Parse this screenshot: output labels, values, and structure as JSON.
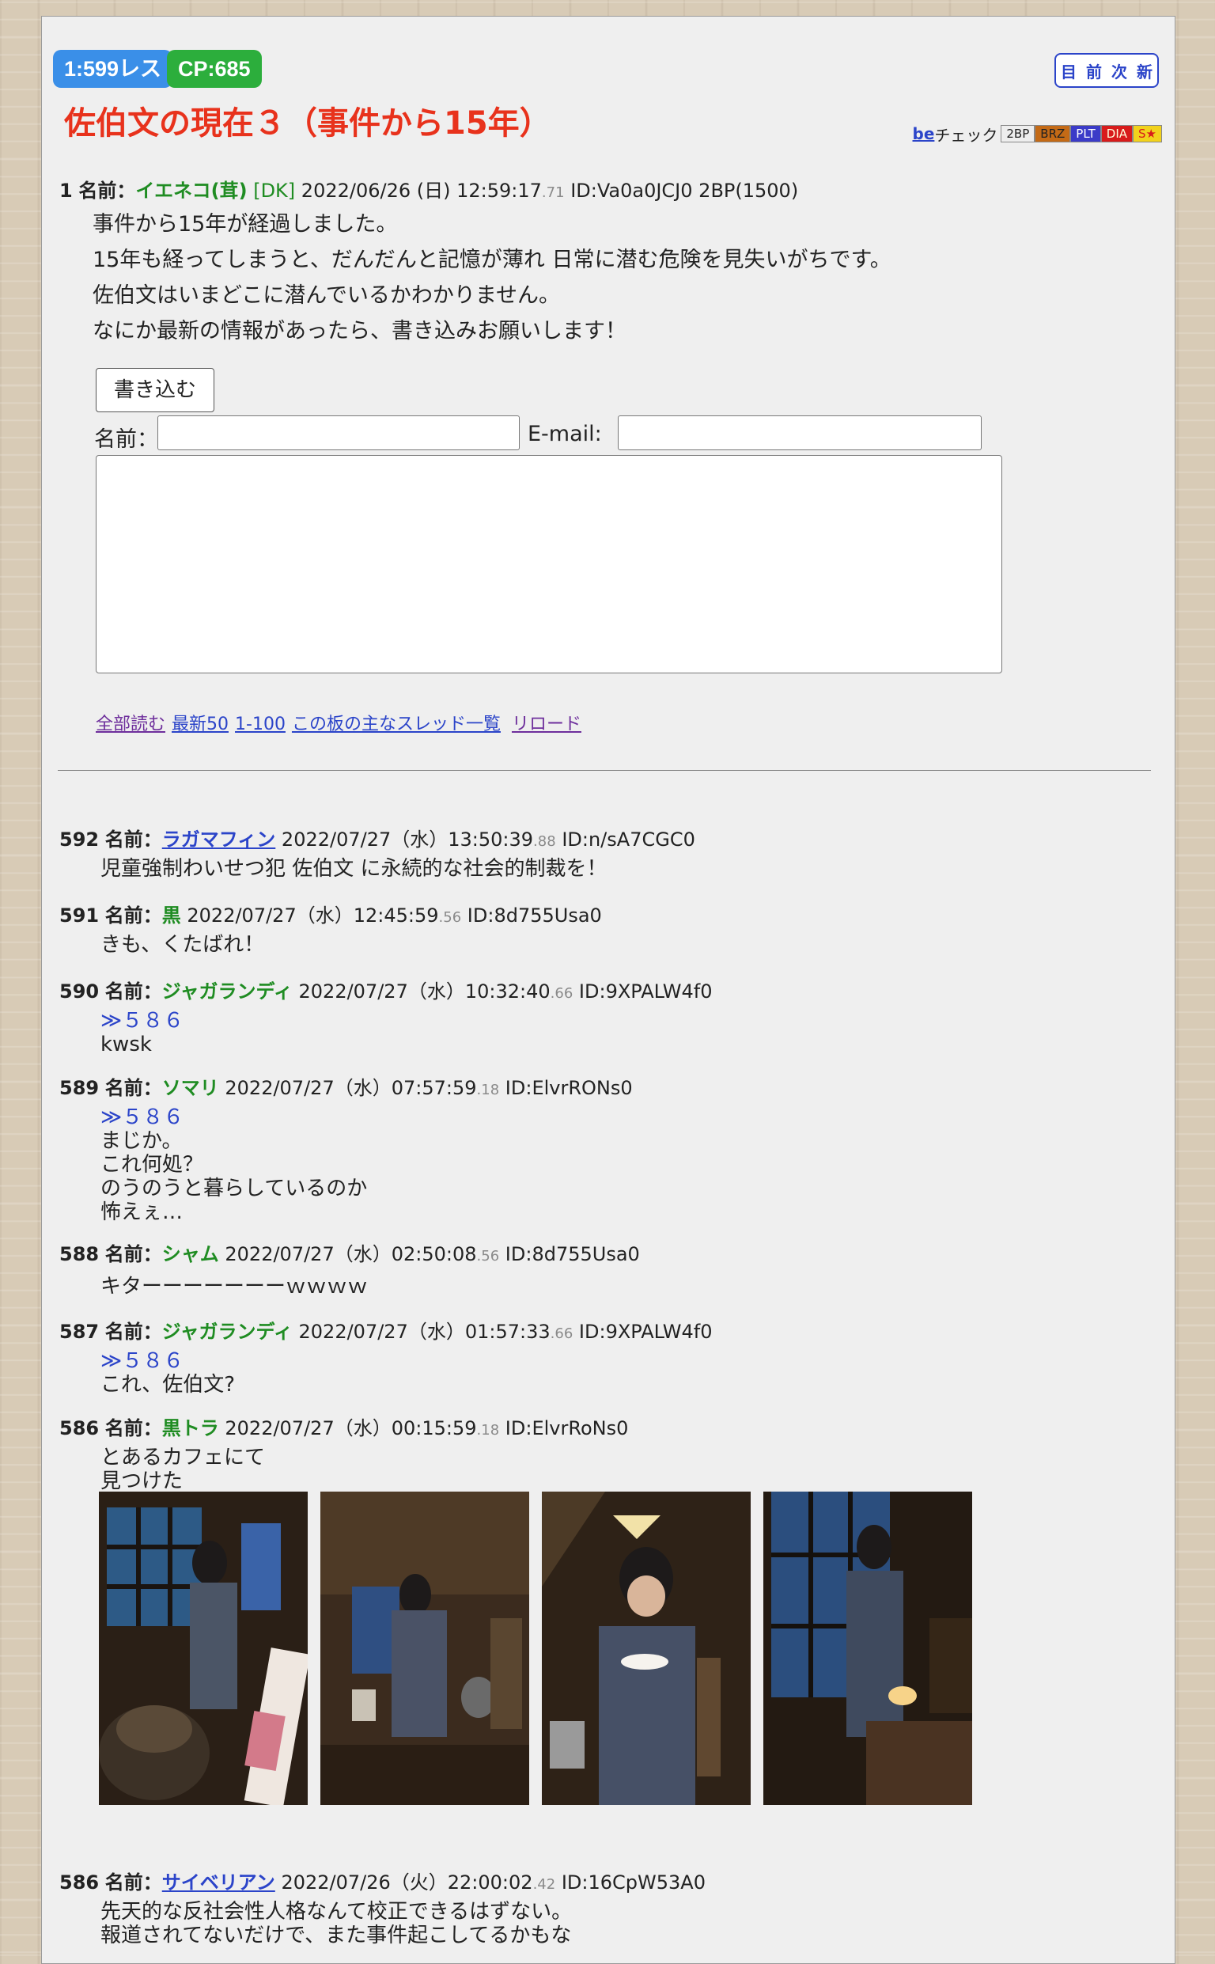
{
  "header": {
    "res_badge": "1:599レス",
    "cp_badge": "CP:685",
    "nav": [
      "目",
      "前",
      "次",
      "新"
    ],
    "title": "佐伯文の現在３（事件から15年）",
    "becheck": {
      "be": "be",
      "check": "チェック",
      "tags": [
        "2BP",
        "BRZ",
        "PLT",
        "DIA",
        "S★"
      ]
    }
  },
  "op": {
    "num": "1",
    "name_label": "名前：",
    "name": "イエネコ(茸)",
    "dk": "[DK]",
    "date": "2022/06/26 (日) 12:59:17",
    "ms": ".71",
    "id": "ID:Va0a0JCJ0",
    "bp": "2BP(1500)",
    "lines": [
      "事件から15年が経過しました。",
      "15年も経ってしまうと、だんだんと記憶が薄れ 日常に潜む危険を見失いがちです。",
      "佐伯文はいまどこに潜んでいるかわかりません。",
      "なにか最新の情報があったら、書き込みお願いします！"
    ]
  },
  "form": {
    "write_button": "書き込む",
    "name_label": "名前：",
    "email_label": "E-mail:"
  },
  "links": [
    "全部読む",
    "最新50",
    "1-100",
    "この板の主なスレッド一覧",
    "リロード"
  ],
  "posts": [
    {
      "num": "592",
      "name": "ラガマフィン",
      "name_style": "blue",
      "date": "2022/07/27（水）13:50:39",
      "ms": ".88",
      "id": "ID:n/sA7CGC0",
      "anchor": "",
      "lines": [
        "児童強制わいせつ犯 佐伯文 に永続的な社会的制裁を！"
      ]
    },
    {
      "num": "591",
      "name": "黒",
      "name_style": "green",
      "date": "2022/07/27（水）12:45:59",
      "ms": ".56",
      "id": "ID:8d755Usa0",
      "anchor": "",
      "lines": [
        "きも、くたばれ！"
      ]
    },
    {
      "num": "590",
      "name": "ジャガランディ",
      "name_style": "green",
      "date": "2022/07/27（水）10:32:40",
      "ms": ".66",
      "id": "ID:9XPALW4f0",
      "anchor": "≫５８６",
      "lines": [
        "kwsk"
      ]
    },
    {
      "num": "589",
      "name": "ソマリ",
      "name_style": "green",
      "date": "2022/07/27（水）07:57:59",
      "ms": ".18",
      "id": "ID:ElvrRONs0",
      "anchor": "≫５８６",
      "lines": [
        "まじか。",
        "これ何処？",
        "のうのうと暮らしているのか",
        "怖えぇ…"
      ]
    },
    {
      "num": "588",
      "name": "シャム",
      "name_style": "green",
      "date": "2022/07/27（水）02:50:08",
      "ms": ".56",
      "id": "ID:8d755Usa0",
      "anchor": "",
      "lines": [
        "キターーーーーーーｗｗｗｗ"
      ]
    },
    {
      "num": "587",
      "name": "ジャガランディ",
      "name_style": "green",
      "date": "2022/07/27（水）01:57:33",
      "ms": ".66",
      "id": "ID:9XPALW4f0",
      "anchor": "≫５８６",
      "lines": [
        "これ、佐伯文?"
      ]
    },
    {
      "num": "586",
      "name": "黒トラ",
      "name_style": "green",
      "date": "2022/07/27（水）00:15:59",
      "ms": ".18",
      "id": "ID:ElvrRoNs0",
      "anchor": "",
      "lines": [
        "とあるカフェにて",
        "見つけた"
      ]
    },
    {
      "num": "586",
      "name": "サイベリアン",
      "name_style": "blue",
      "date": "2022/07/26（火）22:00:02",
      "ms": ".42",
      "id": "ID:16CpW53A0",
      "anchor": "",
      "lines": [
        "先天的な反社会性人格なんて校正できるはずない。",
        "報道されてないだけで、また事件起こしてるかもな"
      ]
    }
  ],
  "photos": [
    "cafe-photo-1",
    "cafe-photo-2",
    "cafe-photo-3",
    "cafe-photo-4"
  ]
}
